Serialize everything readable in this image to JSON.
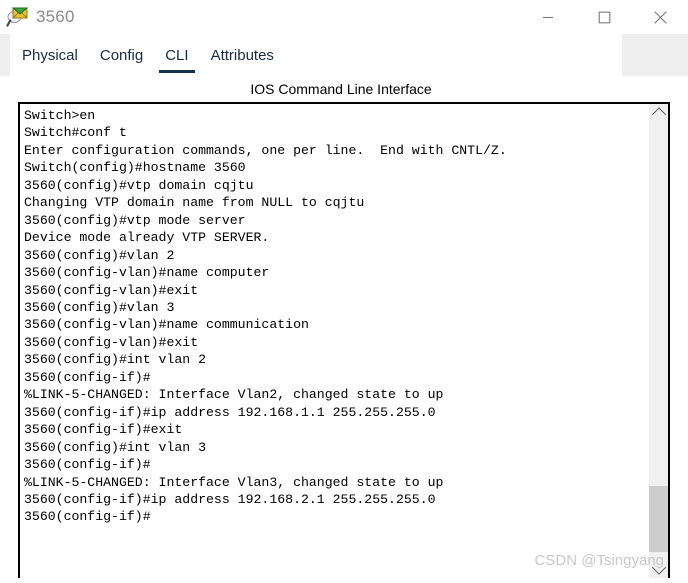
{
  "window": {
    "title": "3560",
    "icon": "envelope-magnifier-icon",
    "controls": {
      "minimize_label": "—",
      "maximize_label": "□",
      "close_label": "✕"
    }
  },
  "tabs": [
    {
      "label": "Physical",
      "active": false
    },
    {
      "label": "Config",
      "active": false
    },
    {
      "label": "CLI",
      "active": true
    },
    {
      "label": "Attributes",
      "active": false
    }
  ],
  "panel": {
    "header": "IOS Command Line Interface"
  },
  "terminal": {
    "lines": [
      "Switch>en",
      "Switch#conf t",
      "Enter configuration commands, one per line.  End with CNTL/Z.",
      "Switch(config)#hostname 3560",
      "3560(config)#vtp domain cqjtu",
      "Changing VTP domain name from NULL to cqjtu",
      "3560(config)#vtp mode server",
      "Device mode already VTP SERVER.",
      "3560(config)#vlan 2",
      "3560(config-vlan)#name computer",
      "3560(config-vlan)#exit",
      "3560(config)#vlan 3",
      "3560(config-vlan)#name communication",
      "3560(config-vlan)#exit",
      "3560(config)#int vlan 2",
      "3560(config-if)#",
      "%LINK-5-CHANGED: Interface Vlan2, changed state to up",
      "",
      "3560(config-if)#ip address 192.168.1.1 255.255.255.0",
      "3560(config-if)#exit",
      "3560(config)#int vlan 3",
      "3560(config-if)#",
      "%LINK-5-CHANGED: Interface Vlan3, changed state to up",
      "",
      "3560(config-if)#ip address 192.168.2.1 255.255.255.0",
      "3560(config-if)#"
    ]
  },
  "scrollbar": {
    "up_arrow": "chevron-up-icon",
    "down_arrow": "chevron-down-icon"
  },
  "watermark": {
    "text": "CSDN @Tsingyang"
  },
  "colors": {
    "tab_text": "#1a2a44",
    "active_tab_underline": "#16304f",
    "title_text": "#8a8a8a",
    "terminal_text": "#000000",
    "scrollbar_thumb": "#cdcdcd",
    "watermark": "#c9c9c9"
  }
}
